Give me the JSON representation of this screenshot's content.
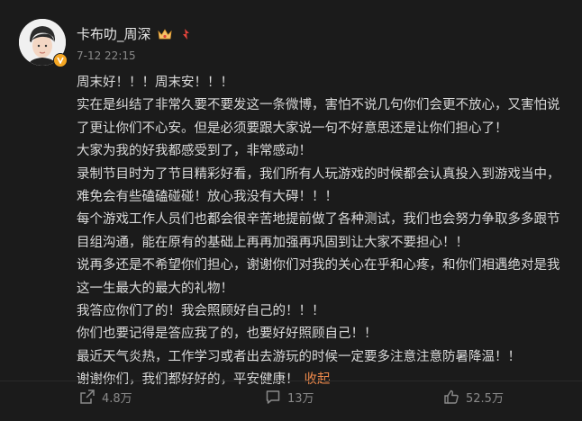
{
  "author": {
    "name": "卡布叻_周深",
    "time": "7-12 22:15",
    "avatar": "avatar-photo",
    "badges": [
      "crown-icon",
      "level-icon"
    ]
  },
  "post": {
    "lines": [
      "周末好！！！周末安！！！",
      "实在是纠结了非常久要不要发这一条微博，害怕不说几句你们会更不放心，又害怕说了更让你们不心安。但是必须要跟大家说一句不好意思还是让你们担心了！",
      "大家为我的好我都感受到了，非常感动！",
      "录制节目时为了节目精彩好看，我们所有人玩游戏的时候都会认真投入到游戏当中，难免会有些磕磕碰碰！放心我没有大碍！！！",
      "每个游戏工作人员们也都会很辛苦地提前做了各种测试，我们也会努力争取多多跟节目组沟通，能在原有的基础上再再加强再巩固到让大家不要担心！！",
      "说再多还是不希望你们担心，谢谢你们对我的关心在乎和心疼，和你们相遇绝对是我这一生最大的最大的礼物！",
      "我答应你们了的！我会照顾好自己的！！！",
      "你们也要记得是答应我了的，也要好好照顾自己！！",
      "最近天气炎热，工作学习或者出去游玩的时候一定要多注意注意防暑降温！！",
      "谢谢你们，我们都好好的，平安健康！"
    ],
    "collapse_label": "收起"
  },
  "actions": {
    "share": {
      "icon": "share-icon",
      "count": "4.8万"
    },
    "comment": {
      "icon": "comment-icon",
      "count": "13万"
    },
    "like": {
      "icon": "like-icon",
      "count": "52.5万"
    }
  },
  "colors": {
    "background": "#1b1b1b",
    "text": "#d9d9d9",
    "muted": "#8a8a8a",
    "accent": "#f08a4b",
    "verified": "#f5a623"
  }
}
